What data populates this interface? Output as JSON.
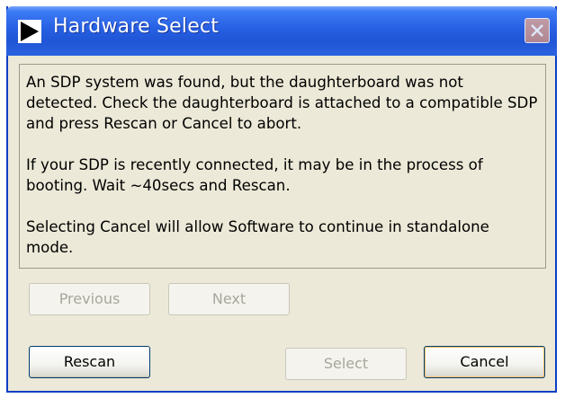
{
  "window": {
    "title": "Hardware Select",
    "icon": "play-arrow-icon",
    "close_icon": "close-icon"
  },
  "message": {
    "paragraphs": [
      "An SDP system was found, but the daughterboard was not detected. Check the daughterboard is attached to a compatible SDP and press Rescan or Cancel to abort.",
      "If your SDP is recently connected, it may be in the process of booting. Wait ~40secs and Rescan.",
      "Selecting Cancel will allow Software to continue in standalone mode."
    ]
  },
  "buttons": {
    "previous": "Previous",
    "next": "Next",
    "rescan": "Rescan",
    "select": "Select",
    "cancel": "Cancel"
  },
  "colors": {
    "titlebar": "#2760e3",
    "dialog_background": "#ece9d8",
    "disabled_text": "#a8a69b"
  }
}
